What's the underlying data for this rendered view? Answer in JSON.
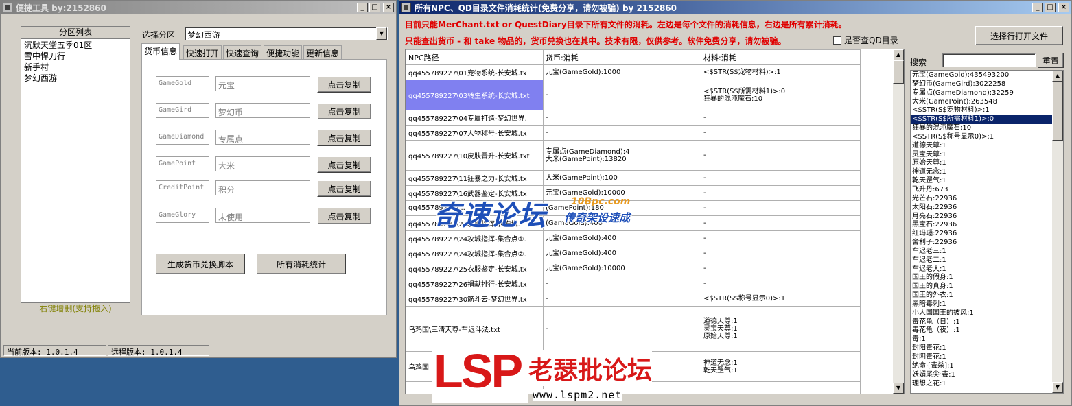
{
  "left_window": {
    "title": "便捷工具   by:2152860",
    "controls": {
      "minimize": "_",
      "maximize": "□",
      "close": "×"
    },
    "zone_list": {
      "header": "分区列表",
      "items": [
        "沉默天堂五季01区",
        "雪中悍刀行",
        "新手村",
        "梦幻西游"
      ],
      "footer": "右键增删(支持拖入)"
    },
    "select_zone_label": "选择分区",
    "select_zone_value": "梦幻西游",
    "tabs": [
      "货币信息",
      "快速打开",
      "快速查询",
      "便捷功能",
      "更新信息"
    ],
    "currency_rows": [
      {
        "key": "GameGold",
        "name": "元宝",
        "button": "点击复制"
      },
      {
        "key": "GameGird",
        "name": "梦幻币",
        "button": "点击复制"
      },
      {
        "key": "GameDiamond",
        "name": "专属点",
        "button": "点击复制"
      },
      {
        "key": "GamePoint",
        "name": "大米",
        "button": "点击复制"
      },
      {
        "key": "CreditPoint",
        "name": "积分",
        "button": "点击复制"
      },
      {
        "key": "GameGlory",
        "name": "未使用",
        "button": "点击复制"
      }
    ],
    "generate_button": "生成货币兑换脚本",
    "stats_button": "所有消耗统计",
    "status": {
      "current_version": "当前版本: 1.0.1.4",
      "remote_version": "远程版本: 1.0.1.4"
    }
  },
  "right_window": {
    "title": "所有NPC、QD目录文件消耗统计(免费分享，请勿被骗)     by 2152860",
    "controls": {
      "minimize": "_",
      "maximize": "□",
      "close": "×"
    },
    "notice_line1": "目前只能MerChant.txt or QuestDiary目录下所有文件的消耗。左边是每个文件的消耗信息，右边是所有累计消耗。",
    "notice_line2": "只能查出货币 - 和 take 物品的，货币兑换也在其中。技术有限，仅供参考。软件免费分享，请勿被骗。",
    "qd_checkbox_label": "是否查QD目录",
    "qd_checkbox_checked": false,
    "open_file_button": "选择行打开文件",
    "search_label": "搜索",
    "search_value": "",
    "reset_button": "重置",
    "table": {
      "headers": [
        "NPC路径",
        "货币:消耗",
        "材料:消耗"
      ],
      "rows": [
        {
          "path": "qq455789227\\01宠物系统-长安城.tx",
          "currency": [
            "元宝(GameGold):1000"
          ],
          "material": [
            "<$STR(S$宠物材料)>:1"
          ]
        },
        {
          "path": "qq455789227\\03转生系统-长安城.txt",
          "currency": [
            "-"
          ],
          "material": [
            "<$STR(S$所需材料1)>:0",
            "狂暴的混沌魔石:10"
          ],
          "selected": true
        },
        {
          "path": "qq455789227\\04专属打造-梦幻世界.",
          "currency": [
            "-"
          ],
          "material": [
            "-"
          ]
        },
        {
          "path": "qq455789227\\07人物称号-长安城.tx",
          "currency": [
            "-"
          ],
          "material": [
            "-"
          ]
        },
        {
          "path": "qq455789227\\10皮肤晋升-长安城.txt",
          "currency": [
            "专属点(GameDiamond):4",
            "大米(GamePoint):13820"
          ],
          "material": [
            "-"
          ]
        },
        {
          "path": "qq455789227\\11狂暴之力-长安城.tx",
          "currency": [
            "大米(GamePoint):100"
          ],
          "material": [
            "-"
          ]
        },
        {
          "path": "qq455789227\\16武器鉴定-长安城.tx",
          "currency": [
            "元宝(GameGold):10000"
          ],
          "material": [
            "-"
          ]
        },
        {
          "path": "qq455789227\\...",
          "currency": [
            "(GamePoint):180"
          ],
          "material": [
            "-"
          ]
        },
        {
          "path": "qq455789227\\24攻城指挥-长安城.",
          "currency": [
            "(GameGold):400"
          ],
          "material": [
            "-"
          ]
        },
        {
          "path": "qq455789227\\24攻城指挥-集合点①.",
          "currency": [
            "元宝(GameGold):400"
          ],
          "material": [
            "-"
          ]
        },
        {
          "path": "qq455789227\\24攻城指挥-集合点②.",
          "currency": [
            "元宝(GameGold):400"
          ],
          "material": [
            "-"
          ]
        },
        {
          "path": "qq455789227\\25衣服鉴定-长安城.tx",
          "currency": [
            "元宝(GameGold):10000"
          ],
          "material": [
            "-"
          ]
        },
        {
          "path": "qq455789227\\26捐献排行-长安城.tx",
          "currency": [
            "-"
          ],
          "material": [
            "-"
          ]
        },
        {
          "path": "qq455789227\\30筋斗云-梦幻世界.tx",
          "currency": [
            "-"
          ],
          "material": [
            "<$STR(S$称号显示0)>:1"
          ]
        },
        {
          "path": "乌鸡国\\三清天尊-车迟斗法.txt",
          "currency": [
            "-"
          ],
          "material": [
            "道德天尊:1",
            "灵宝天尊:1",
            "原始天尊:1"
          ]
        },
        {
          "path": "乌鸡国",
          "currency": [
            ""
          ],
          "material": [
            "神道无念:1",
            "乾天罡气:1"
          ]
        },
        {
          "path": "",
          "currency": [
            ""
          ],
          "material": [
            ""
          ]
        }
      ]
    },
    "totals_list": [
      "元宝(GameGold):435493200",
      "梦幻币(GameGird):3022258",
      "专属点(GameDiamond):32259",
      "大米(GamePoint):263548",
      "<$STR(S$宠物材料)>:1",
      "<$STR(S$所需材料1)>:0",
      "狂暴的混沌魔石:10",
      "<$STR(S$称号显示0)>:1",
      "道德天尊:1",
      "灵宝天尊:1",
      "原始天尊:1",
      "神道无念:1",
      "乾天罡气:1",
      "飞升丹:673",
      "光芒石:22936",
      "太阳石:22936",
      "月亮石:22936",
      "黑宝石:22936",
      "红玛瑙:22936",
      "舍利子:22936",
      "车迟老三:1",
      "车迟老二:1",
      "车迟老大:1",
      "国王的假身:1",
      "国王的真身:1",
      "国王的外衣:1",
      "黑暗毒刺:1",
      "小人国国王的披风:1",
      "毒花龟（日）:1",
      "毒花龟（夜）:1",
      "毒:1",
      "封阳毒花:1",
      "封阴毒花:1",
      "绝命·[毒杀]:1",
      "妖媚尾尖·毒:1",
      "理想之花:1"
    ],
    "totals_highlight_index": 5
  },
  "watermarks": {
    "top_logo": "奇速论坛",
    "top_logo_sub": "传奇架设速成",
    "top_logo_url": "10Bpc.com",
    "bottom_logo": "LSP",
    "bottom_logo_cn": "老瑟批论坛",
    "bottom_logo_url": "www.lspm2.net"
  }
}
